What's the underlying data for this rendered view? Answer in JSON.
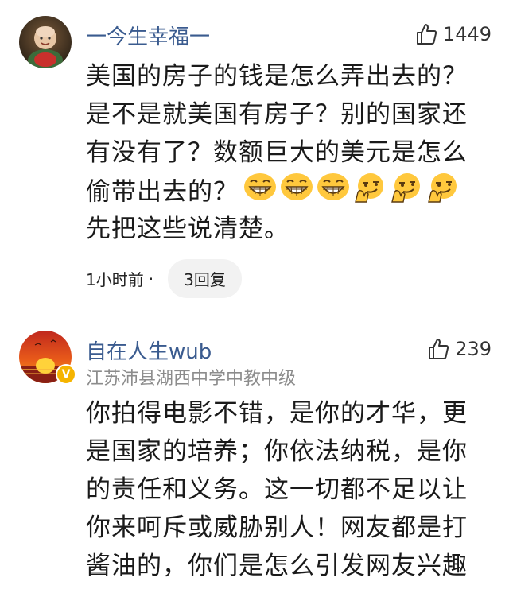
{
  "comments": [
    {
      "username": "一今生幸福一",
      "likes": "1449",
      "lines": [
        "美国的房子的钱是怎么弄出去的？",
        "是不是就美国有房子？别的国家还",
        "有没有了？数额巨大的美元是怎么",
        "偷带出去的？",
        "先把这些说清楚。"
      ],
      "emojis": [
        "grin-emoji",
        "grin-emoji",
        "grin-emoji",
        "smirk-emoji",
        "smirk-emoji",
        "smirk-emoji"
      ],
      "time": "1小时前",
      "separator": "·",
      "replies": "3回复"
    },
    {
      "username": "自在人生wub",
      "subtitle": "江苏沛县湖西中学中教中级",
      "likes": "239",
      "verified": "V",
      "lines": [
        "你拍得电影不错，是你的才华，更",
        "是国家的培养；你依法纳税，是你",
        "的责任和义务。这一切都不足以让",
        "你来呵斥或威胁别人！网友都是打",
        "酱油的，你们是怎么引发网友兴趣"
      ]
    }
  ],
  "colors": {
    "username": "#3a5b8f",
    "muted": "#8c8c8c",
    "pill_bg": "#f2f2f2",
    "emoji_yellow": "#ffc83d"
  }
}
